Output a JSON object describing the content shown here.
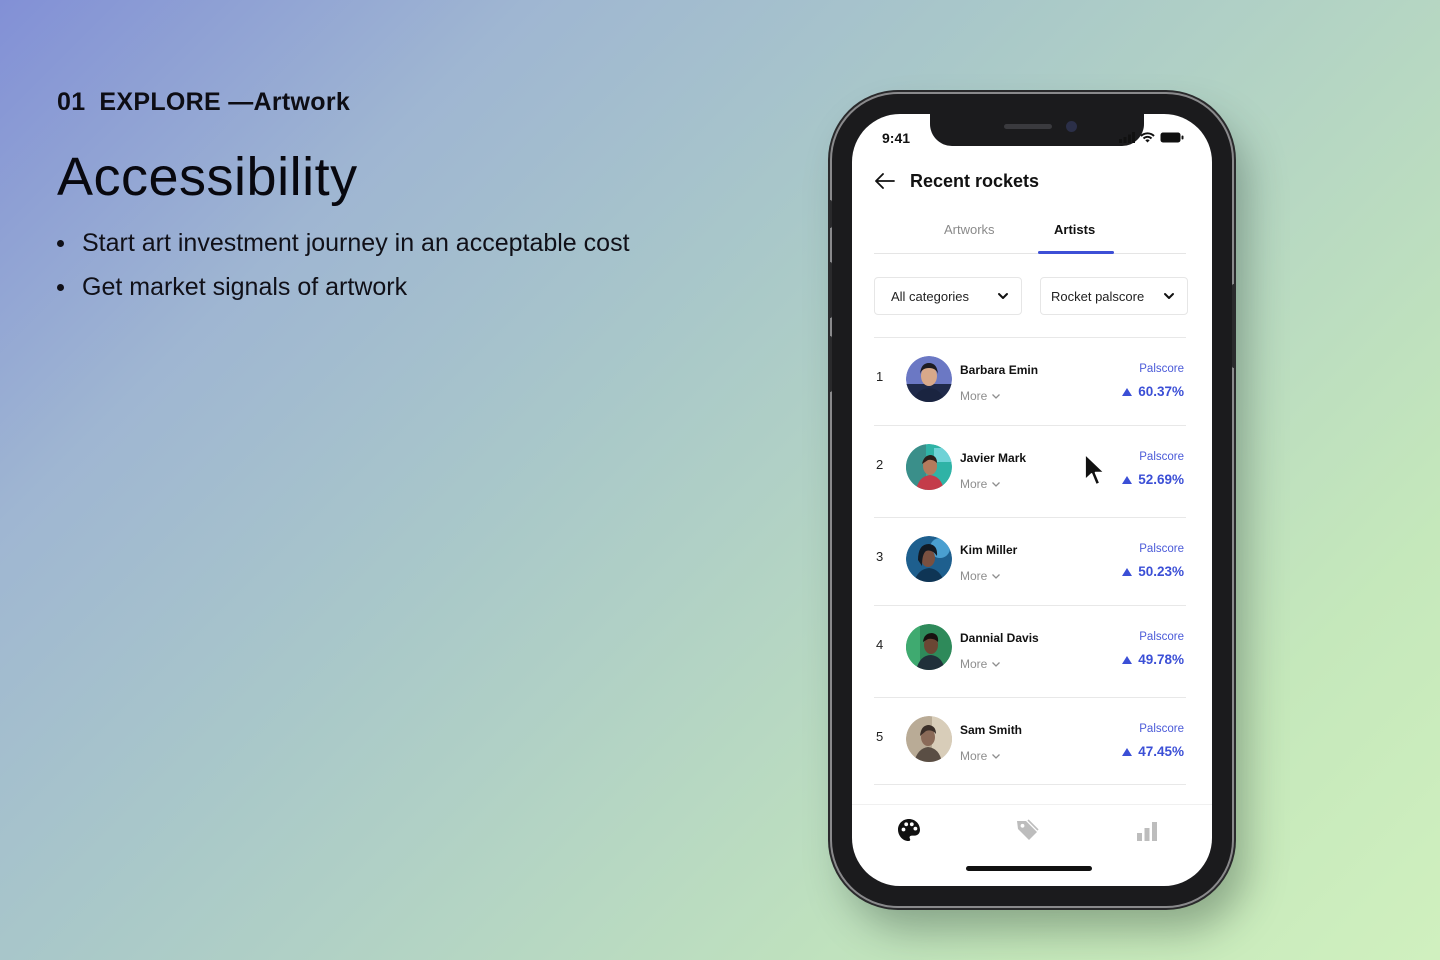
{
  "slide": {
    "section_number": "01",
    "section_label": "EXPLORE —Artwork",
    "title": "Accessibility",
    "bullets": [
      "Start art investment journey in an acceptable cost",
      "Get market signals of artwork"
    ]
  },
  "phone": {
    "status_time": "9:41",
    "header_title": "Recent rockets",
    "tabs": [
      {
        "label": "Artworks",
        "active": false
      },
      {
        "label": "Artists",
        "active": true
      }
    ],
    "filters": {
      "category": "All categories",
      "sort": "Rocket palscore"
    },
    "artists": [
      {
        "rank": "1",
        "name": "Barbara Emin",
        "more": "More",
        "score_label": "Palscore",
        "score": "60.37%"
      },
      {
        "rank": "2",
        "name": "Javier Mark",
        "more": "More",
        "score_label": "Palscore",
        "score": "52.69%"
      },
      {
        "rank": "3",
        "name": "Kim Miller",
        "more": "More",
        "score_label": "Palscore",
        "score": "50.23%"
      },
      {
        "rank": "4",
        "name": "Dannial Davis",
        "more": "More",
        "score_label": "Palscore",
        "score": "49.78%"
      },
      {
        "rank": "5",
        "name": "Sam Smith",
        "more": "More",
        "score_label": "Palscore",
        "score": "47.45%"
      }
    ],
    "bottom_nav": [
      "palette-icon",
      "tag-icon",
      "bar-chart-icon"
    ],
    "accent_color": "#3b4fd6"
  }
}
